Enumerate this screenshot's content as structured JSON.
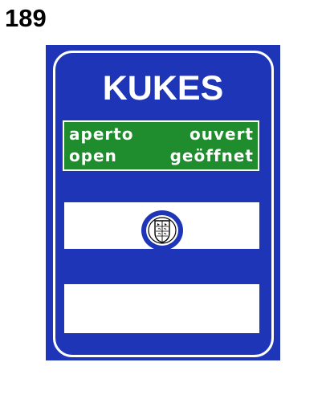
{
  "sign": {
    "number": "189",
    "title": "KUKES",
    "status": {
      "top_left": "aperto",
      "top_right": "ouvert",
      "bottom_left": "open",
      "bottom_right": "geöffnet"
    },
    "colors": {
      "panel_blue": "#1f35b8",
      "status_green": "#1f8c2e",
      "border_white": "#ffffff"
    },
    "emblem_icon": "coat-of-arms-icon"
  }
}
